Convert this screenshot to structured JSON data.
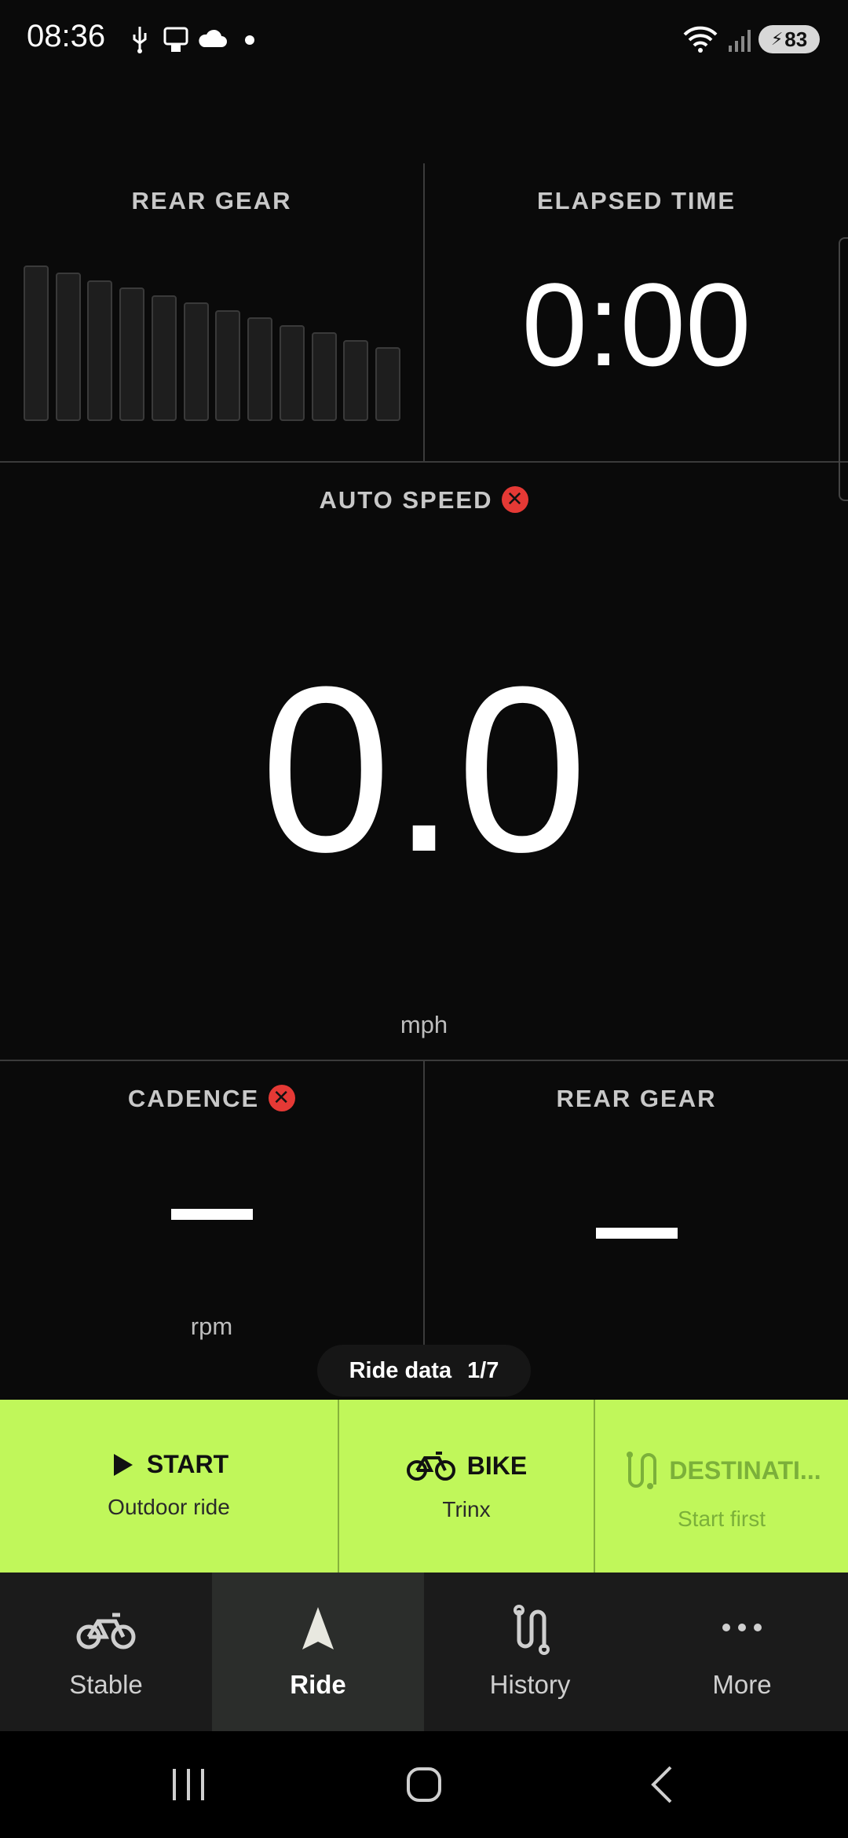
{
  "status_bar": {
    "time": "08:36",
    "battery": "83",
    "icons": [
      "usb-icon",
      "nfc-icon",
      "cloud-icon",
      "dot-icon",
      "wifi-icon",
      "signal-icon",
      "battery-icon"
    ]
  },
  "tiles": {
    "rear_gear_top": {
      "label": "REAR GEAR",
      "gear_count": 12
    },
    "elapsed_time": {
      "label": "ELAPSED TIME",
      "value": "0:00"
    },
    "auto_speed": {
      "label": "AUTO SPEED",
      "value": "0.0",
      "unit": "mph",
      "error": true
    },
    "cadence": {
      "label": "CADENCE",
      "unit": "rpm",
      "error": true
    },
    "rear_gear_bottom": {
      "label": "REAR GEAR"
    }
  },
  "pager": {
    "label": "Ride data",
    "position": "1/7"
  },
  "actions": [
    {
      "title": "START",
      "subtitle": "Outdoor ride",
      "icon": "play-icon"
    },
    {
      "title": "BIKE",
      "subtitle": "Trinx",
      "icon": "bike-icon"
    },
    {
      "title": "DESTINATI...",
      "subtitle": "Start first",
      "icon": "route-icon",
      "disabled": true
    }
  ],
  "nav": [
    {
      "label": "Stable",
      "icon": "bike-icon"
    },
    {
      "label": "Ride",
      "icon": "navigation-arrow-icon",
      "active": true
    },
    {
      "label": "History",
      "icon": "route-icon"
    },
    {
      "label": "More",
      "icon": "more-dots-icon"
    }
  ],
  "colors": {
    "accent": "#c0f75a",
    "error": "#e53935",
    "background": "#0a0a0a"
  }
}
